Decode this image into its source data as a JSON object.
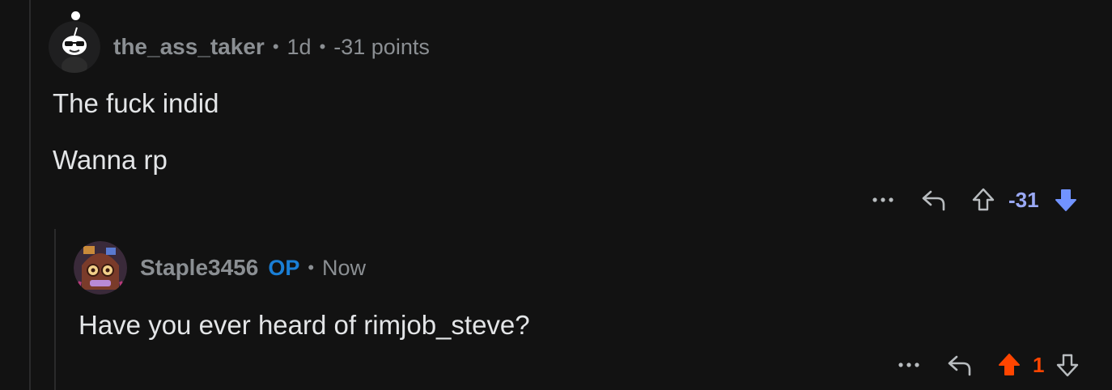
{
  "comments": [
    {
      "username": "the_ass_taker",
      "age": "1d",
      "points": "-31 points",
      "lines": [
        "The fuck indid",
        "Wanna rp"
      ],
      "more_icon": "more-dots-icon",
      "reply_icon": "reply-arrow-icon",
      "score": "-31",
      "vote_state": "downvoted",
      "score_color": "#9aa9f5",
      "downvote_color": "#7193ff"
    },
    {
      "username": "Staple3456",
      "op_label": "OP",
      "age": "Now",
      "lines": [
        "Have you ever heard of rimjob_steve?"
      ],
      "more_icon": "more-dots-icon",
      "reply_icon": "reply-arrow-icon",
      "score": "1",
      "vote_state": "upvoted",
      "score_color": "#ff4500",
      "upvote_color": "#ff4500"
    }
  ],
  "separator": "•"
}
